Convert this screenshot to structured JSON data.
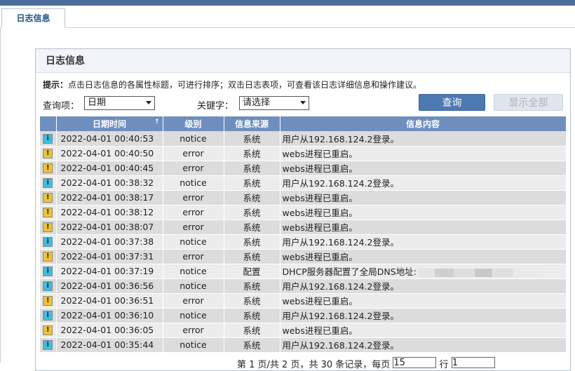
{
  "tab": {
    "label": "日志信息"
  },
  "panel": {
    "title": "日志信息"
  },
  "tip": {
    "prefix": "提示：",
    "text": "点击日志信息的各属性标题，可进行排序；双击日志表项，可查看该日志详细信息和操作建议。"
  },
  "filter": {
    "query_label": "查询项：",
    "query_value": "日期",
    "keyword_label": "关键字：",
    "keyword_value": "请选择",
    "query_button": "查询",
    "show_all_button": "显示全部"
  },
  "table": {
    "headers": [
      "",
      "日期时间",
      "级别",
      "信息来源",
      "信息内容"
    ],
    "sort_indicator": "↑",
    "rows": [
      {
        "level": "notice",
        "time": "2022-04-01 00:40:53",
        "source": "系统",
        "message": "用户从192.168.124.2登录。"
      },
      {
        "level": "error",
        "time": "2022-04-01 00:40:50",
        "source": "系统",
        "message": "webs进程已重启。"
      },
      {
        "level": "error",
        "time": "2022-04-01 00:40:45",
        "source": "系统",
        "message": "webs进程已重启。"
      },
      {
        "level": "notice",
        "time": "2022-04-01 00:38:32",
        "source": "系统",
        "message": "用户从192.168.124.2登录。"
      },
      {
        "level": "error",
        "time": "2022-04-01 00:38:17",
        "source": "系统",
        "message": "webs进程已重启。"
      },
      {
        "level": "error",
        "time": "2022-04-01 00:38:12",
        "source": "系统",
        "message": "webs进程已重启。"
      },
      {
        "level": "error",
        "time": "2022-04-01 00:38:07",
        "source": "系统",
        "message": "webs进程已重启。"
      },
      {
        "level": "notice",
        "time": "2022-04-01 00:37:38",
        "source": "系统",
        "message": "用户从192.168.124.2登录。"
      },
      {
        "level": "error",
        "time": "2022-04-01 00:37:31",
        "source": "系统",
        "message": "webs进程已重启。"
      },
      {
        "level": "notice",
        "time": "2022-04-01 00:37:19",
        "source": "配置",
        "message": "DHCP服务器配置了全局DNS地址:"
      },
      {
        "level": "notice",
        "time": "2022-04-01 00:36:56",
        "source": "系统",
        "message": "用户从192.168.124.2登录。"
      },
      {
        "level": "error",
        "time": "2022-04-01 00:36:51",
        "source": "系统",
        "message": "webs进程已重启。"
      },
      {
        "level": "notice",
        "time": "2022-04-01 00:36:10",
        "source": "系统",
        "message": "用户从192.168.124.2登录。"
      },
      {
        "level": "error",
        "time": "2022-04-01 00:36:05",
        "source": "系统",
        "message": "webs进程已重启。"
      },
      {
        "level": "notice",
        "time": "2022-04-01 00:35:44",
        "source": "系统",
        "message": "用户从192.168.124.2登录。"
      }
    ]
  },
  "pager": {
    "text_a": "第 1 页/共 2 页，共 30 条记录，每页",
    "per_page": "15",
    "text_b": "行",
    "page": "1"
  },
  "icons": {
    "notice": "info-icon",
    "error": "warning-icon"
  },
  "colors": {
    "header": "#6e8fbe",
    "notice": "#38c0e0",
    "error": "#f0c230",
    "query_button": "#4d79b1"
  }
}
